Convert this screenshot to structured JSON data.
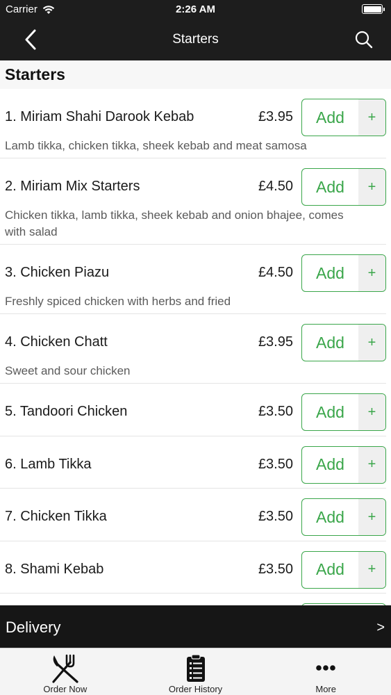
{
  "status_bar": {
    "carrier": "Carrier",
    "time": "2:26 AM"
  },
  "nav": {
    "title": "Starters"
  },
  "section": {
    "title": "Starters"
  },
  "menu_items": [
    {
      "name": "1. Miriam Shahi Darook Kebab",
      "price": "£3.95",
      "description": "Lamb tikka, chicken tikka, sheek kebab and meat samosa",
      "add_label": "Add",
      "plus_label": "+"
    },
    {
      "name": "2. Miriam Mix Starters",
      "price": "£4.50",
      "description": "Chicken tikka, lamb tikka, sheek kebab and onion bhajee, comes with salad",
      "add_label": "Add",
      "plus_label": "+"
    },
    {
      "name": "3. Chicken Piazu",
      "price": "£4.50",
      "description": "Freshly spiced chicken with herbs and fried",
      "add_label": "Add",
      "plus_label": "+"
    },
    {
      "name": "4. Chicken Chatt",
      "price": "£3.95",
      "description": "Sweet and sour chicken",
      "add_label": "Add",
      "plus_label": "+"
    },
    {
      "name": "5. Tandoori Chicken",
      "price": "£3.50",
      "add_label": "Add",
      "plus_label": "+"
    },
    {
      "name": "6. Lamb Tikka",
      "price": "£3.50",
      "add_label": "Add",
      "plus_label": "+"
    },
    {
      "name": "7. Chicken Tikka",
      "price": "£3.50",
      "add_label": "Add",
      "plus_label": "+"
    },
    {
      "name": "8. Shami Kebab",
      "price": "£3.50",
      "add_label": "Add",
      "plus_label": "+"
    }
  ],
  "delivery": {
    "label": "Delivery",
    "chevron": ">"
  },
  "tabs": [
    {
      "label": "Order Now",
      "icon": "fork-knife-icon"
    },
    {
      "label": "Order History",
      "icon": "clipboard-list-icon"
    },
    {
      "label": "More",
      "icon": "more-dots-icon"
    }
  ],
  "colors": {
    "accent": "#3aa64a",
    "header_bg": "#1d1d1d",
    "delivery_bg": "#161616"
  }
}
